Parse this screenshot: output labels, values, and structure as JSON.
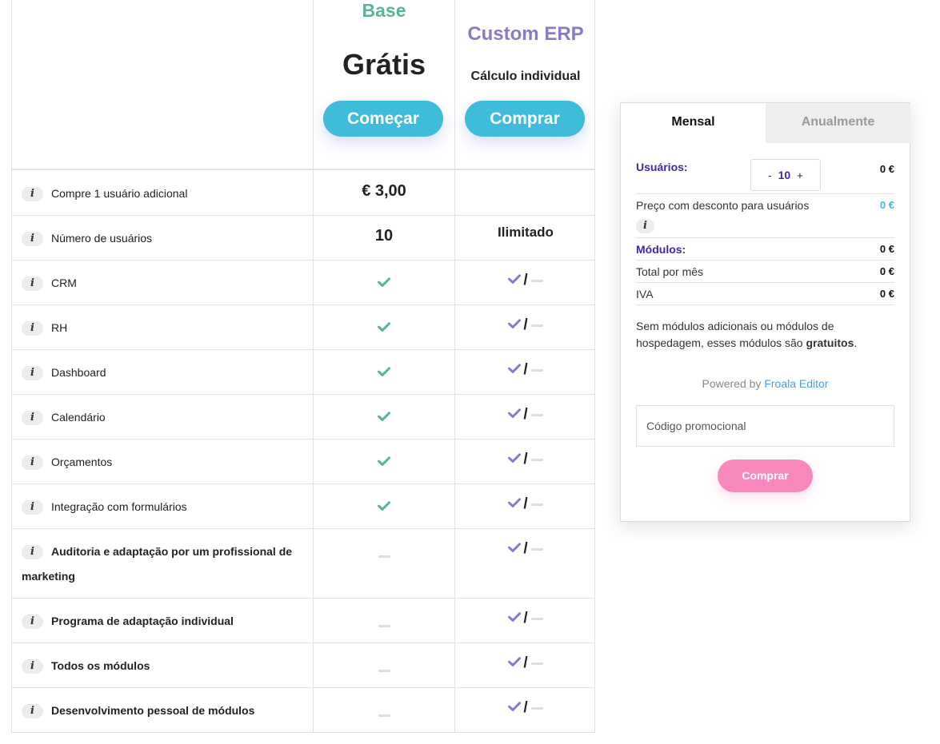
{
  "plans": {
    "base": {
      "title": "Base",
      "price": "Grátis",
      "button": "Começar",
      "color": "#5ab596"
    },
    "custom": {
      "title": "Custom ERP",
      "price": "Cálculo individual",
      "button": "Comprar",
      "color": "#8b7ac6"
    }
  },
  "info_icon": "i",
  "slash": "/",
  "rows": [
    {
      "label": "Compre 1 usuário adicional",
      "bold": false,
      "base": "€ 3,00",
      "custom": ""
    },
    {
      "label": "Número de usuários",
      "bold": false,
      "base": "10",
      "custom": "Ilimitado"
    },
    {
      "label": "CRM",
      "bold": false,
      "base": "check",
      "custom": "check-or-dash"
    },
    {
      "label": "RH",
      "bold": false,
      "base": "check",
      "custom": "check-or-dash"
    },
    {
      "label": "Dashboard",
      "bold": false,
      "base": "check",
      "custom": "check-or-dash"
    },
    {
      "label": "Calendário",
      "bold": false,
      "base": "check",
      "custom": "check-or-dash"
    },
    {
      "label": "Orçamentos",
      "bold": false,
      "base": "check",
      "custom": "check-or-dash"
    },
    {
      "label": "Integração com formulários",
      "bold": false,
      "base": "check",
      "custom": "check-or-dash"
    },
    {
      "label": "Auditoria e adaptação por um profissional de marketing",
      "bold": true,
      "base": "dash",
      "custom": "check-or-dash"
    },
    {
      "label": "Programa de adaptação individual",
      "bold": true,
      "base": "dash",
      "custom": "check-or-dash"
    },
    {
      "label": "Todos os módulos",
      "bold": true,
      "base": "dash",
      "custom": "check-or-dash"
    },
    {
      "label": "Desenvolvimento pessoal de módulos",
      "bold": true,
      "base": "dash",
      "custom": "check-or-dash"
    }
  ],
  "calculator": {
    "tabs": {
      "monthly": "Mensal",
      "yearly": "Anualmente"
    },
    "users_label": "Usuários:",
    "users_minus": "-",
    "users_value": "10",
    "users_plus": "+",
    "users_amount": "0 €",
    "discount_label": "Preço com desconto para usuários",
    "discount_amount": "0 €",
    "modules_label": "Módulos:",
    "modules_amount": "0 €",
    "total_label": "Total por mês",
    "total_amount": "0 €",
    "vat_label": "IVA",
    "vat_amount": "0 €",
    "note_text": "Sem módulos adicionais ou módulos de hospedagem, esses módulos são ",
    "note_bold": "gratuitos",
    "note_end": ".",
    "powered_by": "Powered by",
    "powered_link": "Froala Editor",
    "promo_placeholder": "Código promocional",
    "buy_button": "Comprar"
  },
  "colors": {
    "accent": "#3fbcd9",
    "base_green": "#5ab596",
    "custom_purple": "#8b7ac6",
    "buy_pink": "#f887bc",
    "label_purple": "#3a2aa8"
  }
}
